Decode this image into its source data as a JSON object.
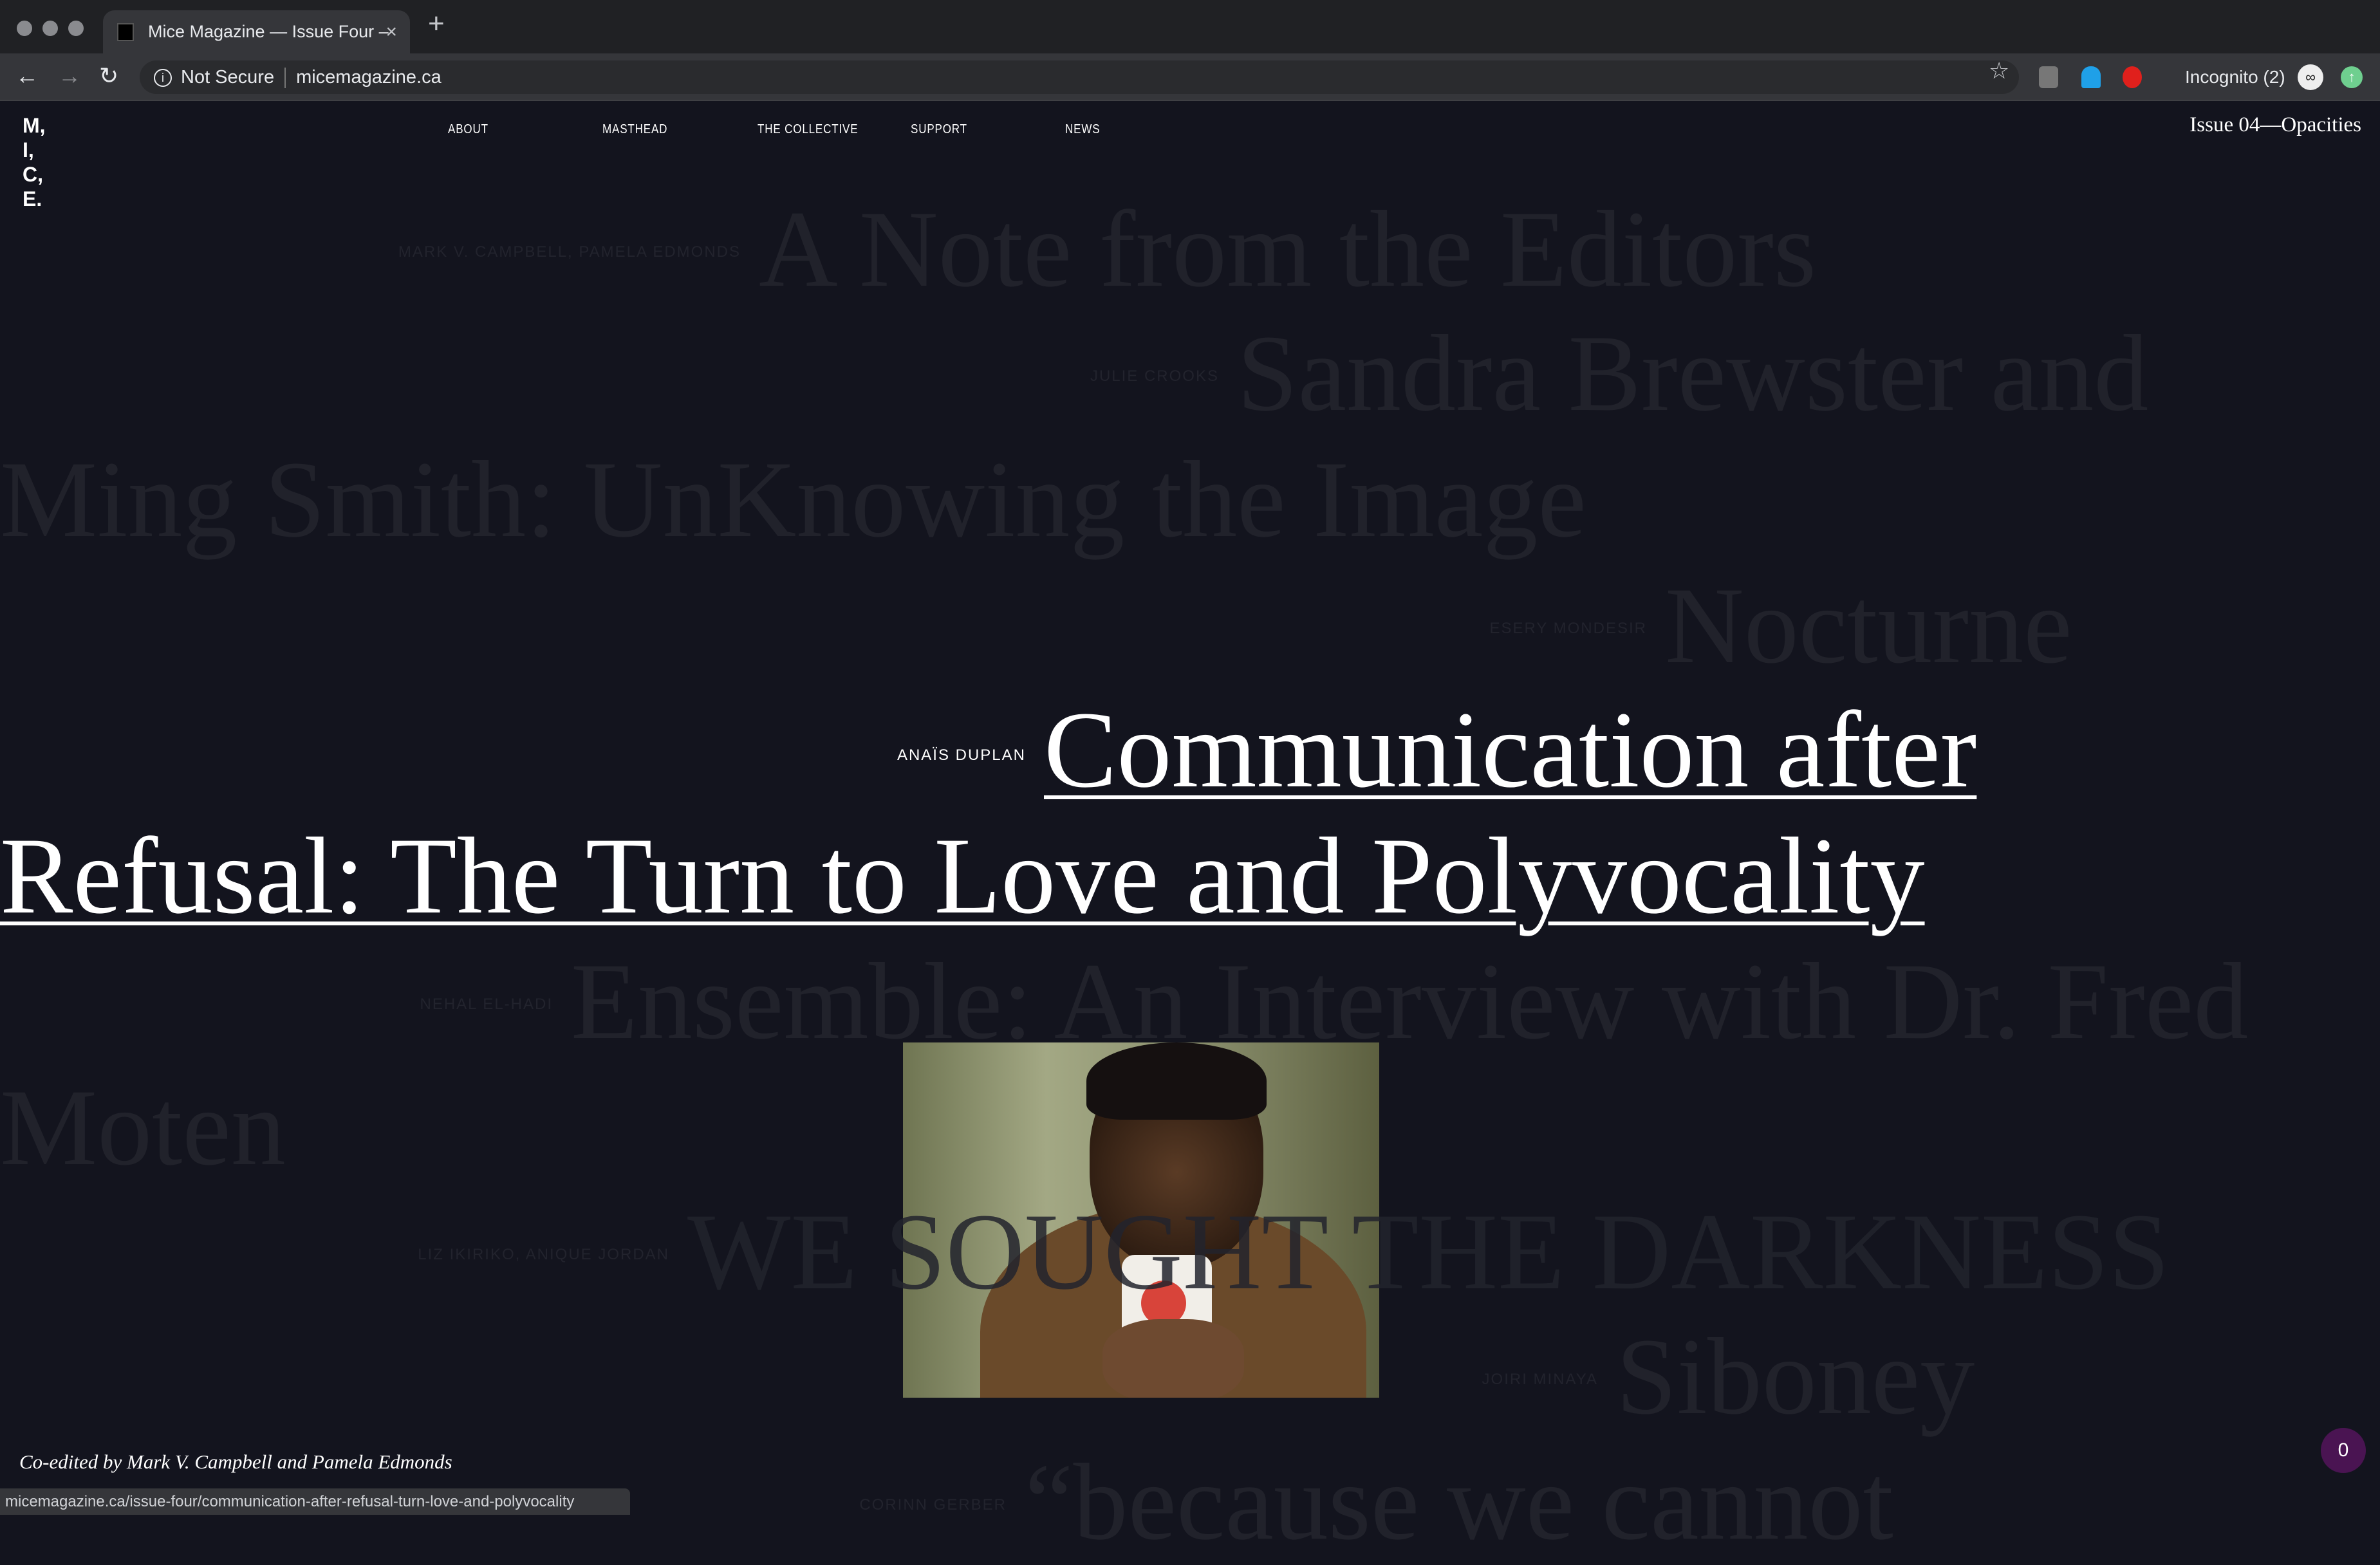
{
  "browser": {
    "tab_title": "Mice Magazine — Issue Four –",
    "security_label": "Not Secure",
    "url": "micemagazine.ca",
    "profile_label": "Incognito (2)",
    "status_url": "micemagazine.ca/issue-four/communication-after-refusal-turn-love-and-polyvocality"
  },
  "site": {
    "logo_lines": [
      "M,",
      "I,",
      "C,",
      "E."
    ],
    "nav": [
      "ABOUT",
      "MASTHEAD",
      "THE COLLECTIVE",
      "SUPPORT",
      "NEWS"
    ],
    "issue": "Issue 04—Opacities",
    "coedited": "Co-edited by Mark V. Campbell and Pamela Edmonds",
    "badge_count": "0"
  },
  "articles": [
    {
      "author": "MARK V. CAMPBELL, PAMELA EDMONDS",
      "title": "A Note from the Editors"
    },
    {
      "author": "JULIE CROOKS",
      "title": "Sandra Brewster and Ming Smith: UnKnowing the Image"
    },
    {
      "author": "ESERY MONDESIR",
      "title": "Nocturne"
    },
    {
      "author": "ANAÏS DUPLAN",
      "title": "Communication after Refusal: The Turn to Love and Polyvocality",
      "featured": true
    },
    {
      "author": "NEHAL EL-HADI",
      "title": "Ensemble: An Interview with Dr. Fred Moten"
    },
    {
      "author": "LIZ IKIRIKO, ANIQUE JORDAN",
      "title": "WE SOUGHT THE DARKNESS"
    },
    {
      "author": "JOIRI MINAYA",
      "title": "Siboney"
    },
    {
      "author": "CORINN GERBER",
      "title": "“because we cannot"
    }
  ]
}
